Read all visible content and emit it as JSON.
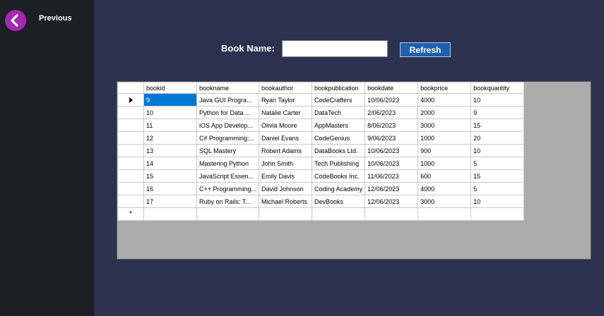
{
  "sidebar": {
    "previous_label": "Previous",
    "back_icon": "chevron-left-icon",
    "back_color": "#a428b3"
  },
  "form": {
    "book_name_label": "Book Name:",
    "book_name_value": "",
    "refresh_label": "Refresh"
  },
  "grid": {
    "columns": [
      "bookid",
      "bookname",
      "bookauthor",
      "bookpublication",
      "bookdate",
      "bookprice",
      "bookquantity"
    ],
    "rows": [
      [
        "9",
        "Java GUI Progra...",
        "Ryan Taylor",
        "CodeCrafters",
        "10/06/2023",
        "4000",
        "10"
      ],
      [
        "10",
        "Python for Data ...",
        " Natalie Carter",
        "DataTech",
        "2/06/2023",
        "2000",
        "9"
      ],
      [
        "11",
        "iOS App Develop...",
        "Olivia Moore",
        "AppMasters",
        "8/06/2023",
        "3000",
        "15"
      ],
      [
        "12",
        "C# Programming:...",
        " Daniel Evans",
        "CodeGenius",
        "9/06/2023",
        "1000",
        "20"
      ],
      [
        "13",
        "SQL Mastery",
        "Robert Adams",
        "DataBooks Ltd.",
        "10/06/2023",
        "900",
        "10"
      ],
      [
        "14",
        "Mastering Python",
        " John Smith",
        " Tech Publishing",
        "10/06/2023",
        "1000",
        "5"
      ],
      [
        "15",
        "JavaScript Essen...",
        "Emily Davis",
        " CodeBooks Inc.",
        "11/06/2023",
        "600",
        "15"
      ],
      [
        "16",
        "C++ Programming...",
        " David Johnson",
        "Coding Academy",
        "12/06/2023",
        "4000",
        "5"
      ],
      [
        "17",
        "Ruby on Rails: T...",
        " Michael Roberts",
        "DevBooks",
        "12/06/2023",
        "3000",
        "10"
      ]
    ],
    "new_row_marker": "*",
    "selected_row": 0,
    "selected_color": "#0078d7"
  }
}
